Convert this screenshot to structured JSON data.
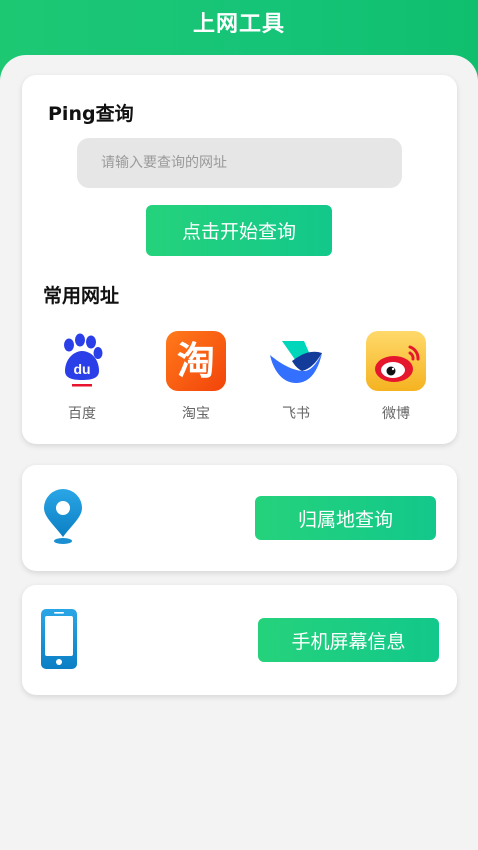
{
  "header": {
    "title": "上网工具"
  },
  "ping": {
    "title": "Ping查询",
    "input_placeholder": "请输入要查询的网址",
    "input_value": "",
    "button_label": "点击开始查询"
  },
  "common_sites": {
    "title": "常用网址",
    "items": [
      {
        "label": "百度",
        "icon": "baidu-logo"
      },
      {
        "label": "淘宝",
        "icon": "taobao-logo",
        "glyph": "淘"
      },
      {
        "label": "飞书",
        "icon": "feishu-logo"
      },
      {
        "label": "微博",
        "icon": "weibo-logo"
      }
    ]
  },
  "location": {
    "icon": "location-pin-icon",
    "button_label": "归属地查询"
  },
  "screen_info": {
    "icon": "mobile-phone-icon",
    "button_label": "手机屏幕信息"
  },
  "colors": {
    "primary_green": "#1dc873",
    "button_green_start": "#25d27c",
    "button_green_end": "#12c88a",
    "icon_blue": "#1a96d8"
  }
}
